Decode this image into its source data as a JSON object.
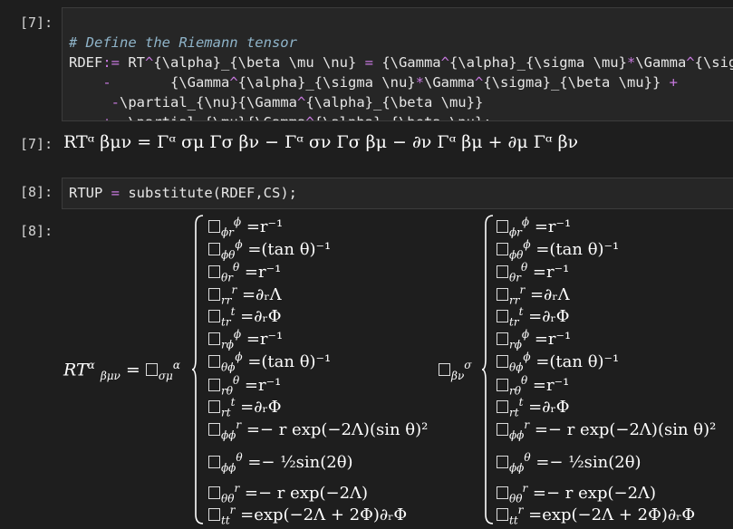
{
  "cells": [
    {
      "in_prompt": "[7]:",
      "code_lines": [
        "# Define the Riemann tensor",
        "RDEF:= RT^{\\alpha}_{\\beta \\mu \\nu} = {\\Gamma^{\\alpha}_{\\sigma \\mu}*\\Gamma^{\\sigma}_{\\beta \\nu}",
        "    -       {\\Gamma^{\\alpha}_{\\sigma \\nu}*\\Gamma^{\\sigma}_{\\beta \\mu}} +",
        "     -\\partial_{\\nu}{\\Gamma^{\\alpha}_{\\beta \\mu}}",
        "    +  \\partial_{\\mu}{\\Gamma^{\\alpha}_{\\beta \\nu};"
      ],
      "out_prompt": "[7]:",
      "output": "RTᵅ βμν = Γᵅ σμ Γσ βν − Γᵅ σν Γσ βμ − ∂ν Γᵅ βμ + ∂μ Γᵅ βν"
    },
    {
      "in_prompt": "[8]:",
      "code_lines": [
        "RTUP = substitute(RDEF,CS);"
      ],
      "out_prompt": "[8]:"
    }
  ],
  "system_rows": [
    {
      "lo": "ϕr",
      "up": "ϕ",
      "rhs": "=r⁻¹"
    },
    {
      "lo": "ϕθ",
      "up": "ϕ",
      "rhs": "=(tan θ)⁻¹"
    },
    {
      "lo": "θr",
      "up": "θ",
      "rhs": "=r⁻¹"
    },
    {
      "lo": "rr",
      "up": "r",
      "rhs": "=∂ᵣΛ"
    },
    {
      "lo": "tr",
      "up": "t",
      "rhs": "=∂ᵣΦ"
    },
    {
      "lo": "rϕ",
      "up": "ϕ",
      "rhs": "=r⁻¹"
    },
    {
      "lo": "θϕ",
      "up": "ϕ",
      "rhs": "=(tan θ)⁻¹"
    },
    {
      "lo": "rθ",
      "up": "θ",
      "rhs": "=r⁻¹"
    },
    {
      "lo": "rt",
      "up": "t",
      "rhs": "=∂ᵣΦ"
    },
    {
      "lo": "ϕϕ",
      "up": "r",
      "rhs": "=− r exp(−2Λ)(sin θ)²"
    },
    {
      "lo": "ϕϕ",
      "up": "θ",
      "rhs": "=− ½sin(2θ)"
    },
    {
      "lo": "θθ",
      "up": "r",
      "rhs": "=− r exp(−2Λ)"
    },
    {
      "lo": "tt",
      "up": "r",
      "rhs": "=exp(−2Λ + 2Φ)∂ᵣΦ"
    }
  ],
  "lhs_a": {
    "main": "RT",
    "sup": "α",
    "sub": "βμν",
    "eq": "=",
    "sym_sub": "σμ",
    "sym_sup": "α"
  },
  "lhs_b": {
    "sym_sub": "βν",
    "sym_sup": "σ"
  }
}
